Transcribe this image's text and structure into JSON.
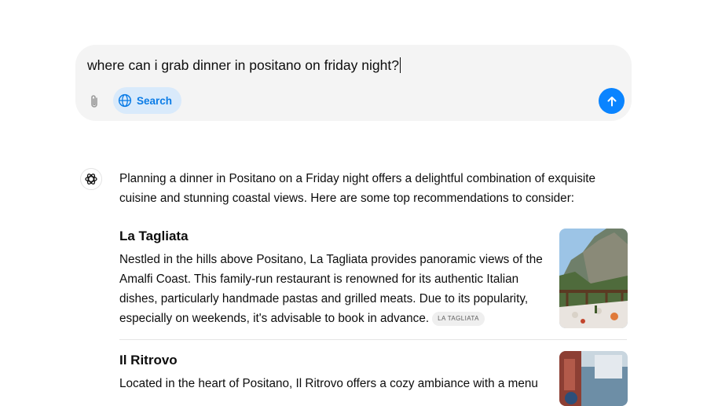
{
  "composer": {
    "query": "where can i grab dinner in positano on friday night?",
    "search_label": "Search"
  },
  "colors": {
    "accent": "#0a84ff",
    "search_bg": "#d9eafb",
    "search_text": "#0b7ce6",
    "composer_bg": "#f4f4f4"
  },
  "icons": {
    "attach": "paperclip-icon",
    "search": "globe-icon",
    "send": "arrow-up-icon",
    "assistant": "openai-logo-icon"
  },
  "response": {
    "intro": "Planning a dinner in Positano on a Friday night offers a delightful combination of exquisite cuisine and stunning coastal views. Here are some top recommendations to consider:",
    "places": [
      {
        "name": "La Tagliata",
        "description": "Nestled in the hills above Positano, La Tagliata provides panoramic views of the Amalfi Coast. This family-run restaurant is renowned for its authentic Italian dishes, particularly handmade pastas and grilled meats. Due to its popularity, especially on weekends, it's advisable to book in advance.",
        "citation": "LA TAGLIATA"
      },
      {
        "name": "Il Ritrovo",
        "description": "Located in the heart of Positano, Il Ritrovo offers a cozy ambiance with a menu"
      }
    ]
  }
}
